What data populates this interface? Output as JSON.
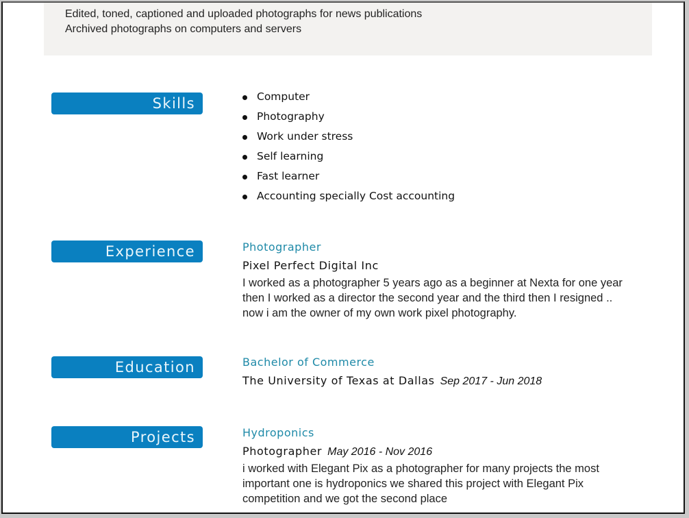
{
  "summary_box": {
    "lines": [
      "Edited, toned, captioned and uploaded photographs for news publications",
      "Archived photographs on computers and servers"
    ]
  },
  "sections": {
    "skills": {
      "title": "Skills",
      "items": [
        "Computer",
        "Photography",
        "Work under stress",
        "Self learning",
        "Fast learner",
        "Accounting specially Cost accounting"
      ]
    },
    "experience": {
      "title": "Experience",
      "role": "Photographer",
      "org": "Pixel Perfect Digital Inc",
      "desc": [
        "I worked as a photographer 5 years ago as a beginner at Nexta for one year",
        "then I worked as a director the second year and the third then I resigned ..",
        "now i am the owner of my own work pixel photography."
      ]
    },
    "education": {
      "title": "Education",
      "degree": "Bachelor of Commerce",
      "school": "The University of Texas at Dallas",
      "dates": "Sep 2017 - Jun 2018"
    },
    "projects": {
      "title": "Projects",
      "name": "Hydroponics",
      "role": "Photographer",
      "dates": "May 2016 - Nov 2016",
      "desc": [
        "i worked with Elegant Pix as a photographer for many projects the most",
        "important one is hydroponics we shared this project with Elegant Pix",
        "competition and we got the second place"
      ]
    }
  },
  "colors": {
    "header_bar": "#0a80c0",
    "accent_text": "#1f8aa8",
    "summary_bg": "#f3f2f0"
  }
}
